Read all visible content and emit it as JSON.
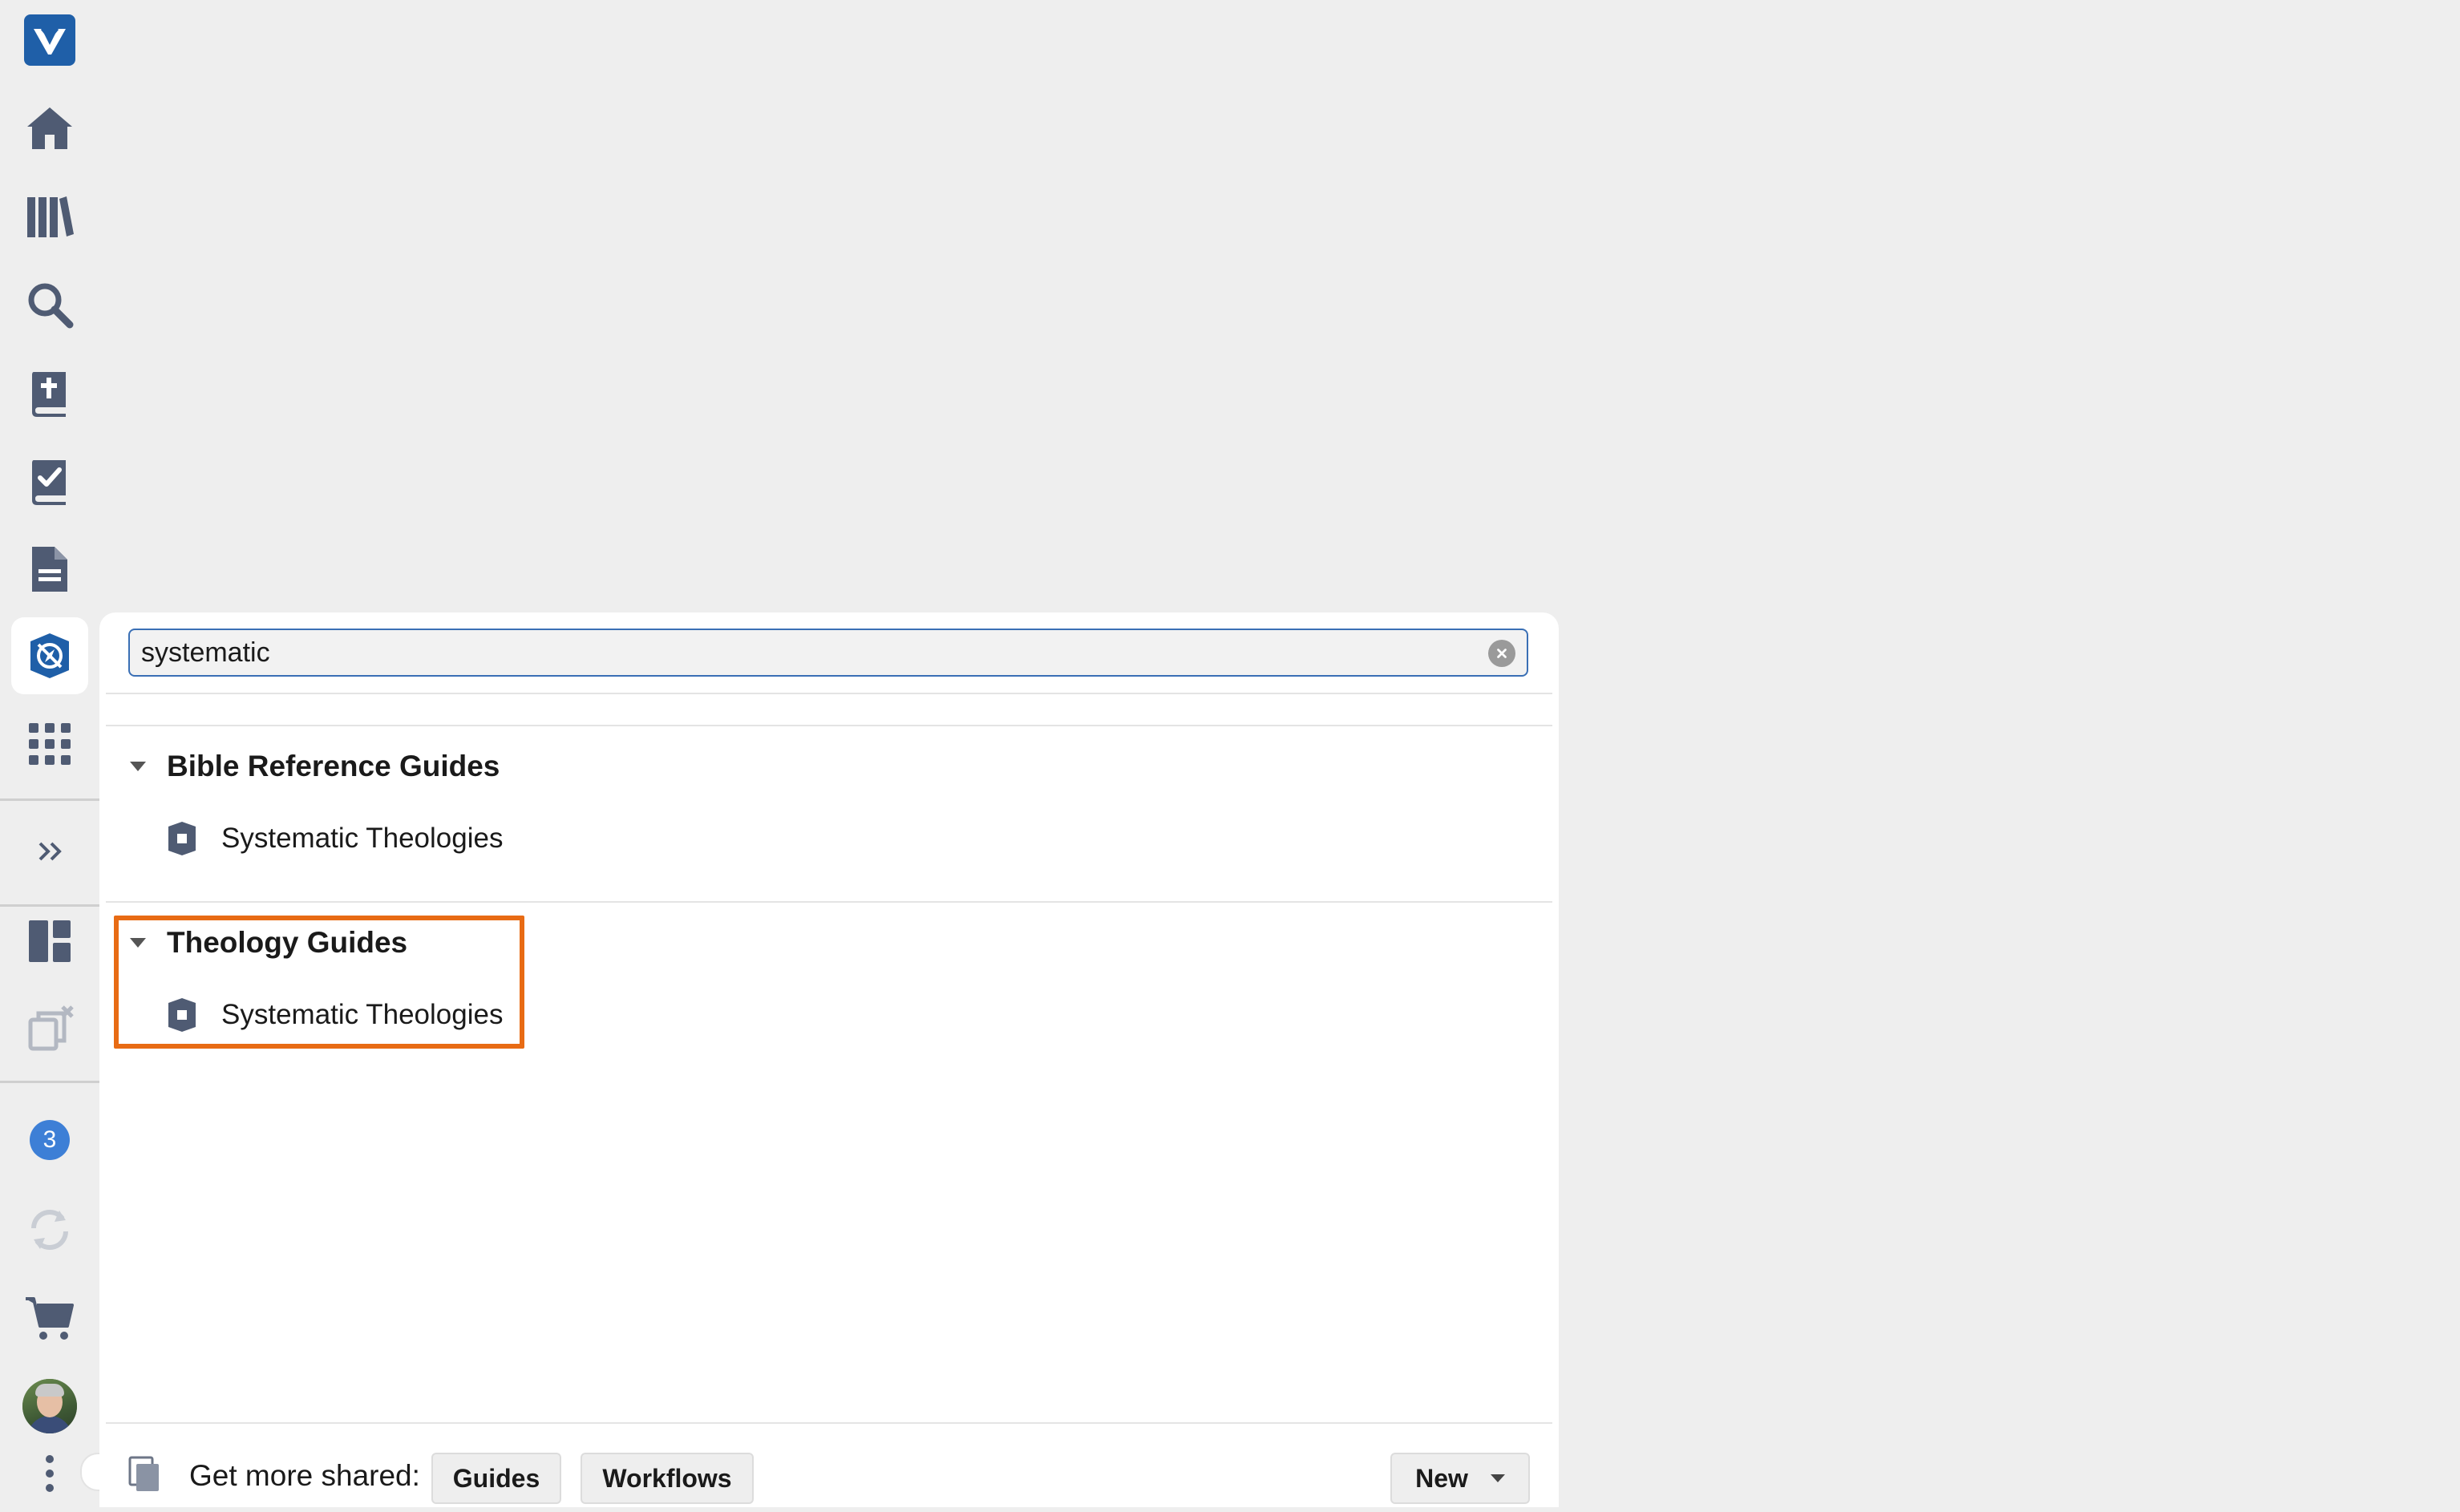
{
  "sidebar": {
    "items": [
      {
        "name": "logos-logo-icon"
      },
      {
        "name": "home-icon"
      },
      {
        "name": "library-icon"
      },
      {
        "name": "search-icon"
      },
      {
        "name": "bible-icon"
      },
      {
        "name": "reading-plan-icon"
      },
      {
        "name": "document-icon"
      },
      {
        "name": "guides-icon",
        "active": true
      },
      {
        "name": "tools-grid-icon"
      },
      {
        "name": "expand-icon"
      },
      {
        "name": "layouts-icon"
      },
      {
        "name": "close-all-panels-icon"
      },
      {
        "name": "notifications-icon",
        "badge": "3"
      },
      {
        "name": "sync-icon"
      },
      {
        "name": "cart-icon"
      },
      {
        "name": "avatar"
      },
      {
        "name": "more-icon"
      }
    ],
    "notification_count": "3"
  },
  "panel": {
    "search": {
      "value": "systematic",
      "placeholder": ""
    },
    "groups": [
      {
        "title": "Bible Reference Guides",
        "items": [
          {
            "label": "Systematic Theologies",
            "icon": "guide-icon"
          }
        ]
      },
      {
        "title": "Theology Guides",
        "items": [
          {
            "label": "Systematic Theologies",
            "icon": "guide-icon"
          }
        ],
        "highlighted": true
      }
    ],
    "footer": {
      "label": "Get more shared:",
      "guides_button": "Guides",
      "workflows_button": "Workflows",
      "new_button": "New"
    }
  },
  "colors": {
    "background": "#eeeeee",
    "icon": "#4f5b73",
    "accent_blue": "#3a6fb5",
    "highlight_orange": "#e86b14",
    "badge_blue": "#3d7fd6"
  }
}
